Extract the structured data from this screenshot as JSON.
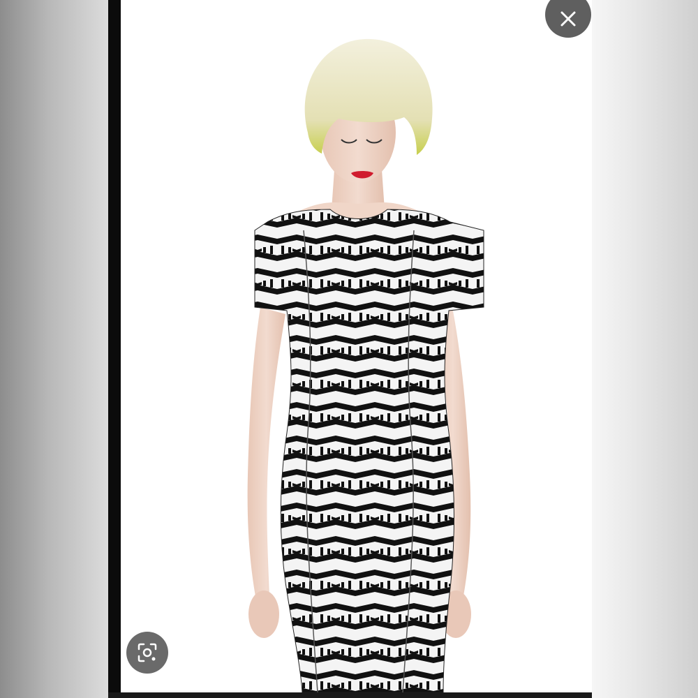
{
  "viewer": {
    "close_icon": "close-icon",
    "lens_icon": "visual-search-icon",
    "button_color": "#5f5f5f",
    "image_subject": "fashion-model-photo"
  },
  "colors": {
    "dress_dark": "#111111",
    "dress_light": "#f4f4f4",
    "hair": "#ece8c4",
    "lips": "#d01c2e",
    "skin": "#efd5c6"
  }
}
